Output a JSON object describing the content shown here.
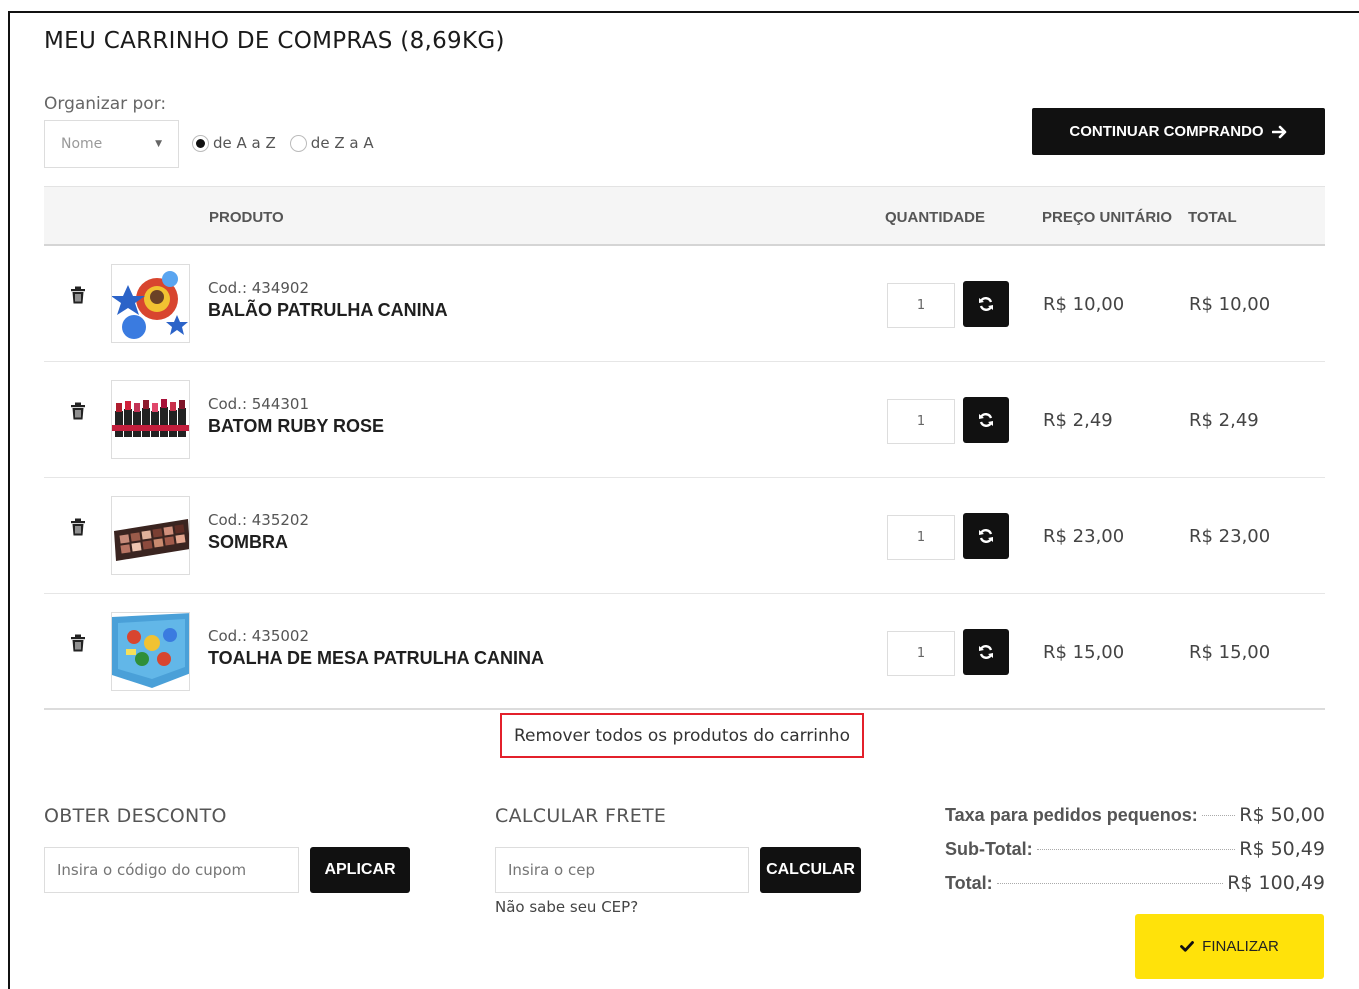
{
  "cart": {
    "title": "MEU CARRINHO DE COMPRAS (8,69KG)"
  },
  "sort": {
    "label": "Organizar por:",
    "select_value": "Nome",
    "options": [
      {
        "label": "de A a Z",
        "checked": true
      },
      {
        "label": "de Z a A",
        "checked": false
      }
    ]
  },
  "continue_button": {
    "label": "CONTINUAR COMPRANDO",
    "icon": "arrow-right-icon"
  },
  "table": {
    "headers": {
      "product": "PRODUTO",
      "quantity": "QUANTIDADE",
      "unit_price": "PREÇO UNITÁRIO",
      "total": "TOTAL"
    },
    "rows": [
      {
        "code": "Cod.: 434902",
        "name": "BALÃO PATRULHA CANINA",
        "qty": "1",
        "unit_price": "R$ 10,00",
        "total": "R$ 10,00",
        "thumb": "balloon-image"
      },
      {
        "code": "Cod.: 544301",
        "name": "BATOM RUBY ROSE",
        "qty": "1",
        "unit_price": "R$ 2,49",
        "total": "R$ 2,49",
        "thumb": "lipstick-image"
      },
      {
        "code": "Cod.: 435202",
        "name": "SOMBRA",
        "qty": "1",
        "unit_price": "R$ 23,00",
        "total": "R$ 23,00",
        "thumb": "eyeshadow-image"
      },
      {
        "code": "Cod.: 435002",
        "name": "TOALHA DE MESA PATRULHA CANINA",
        "qty": "1",
        "unit_price": "R$ 15,00",
        "total": "R$ 15,00",
        "thumb": "tablecloth-image"
      }
    ]
  },
  "remove_all": {
    "label": "Remover todos os produtos do carrinho"
  },
  "discount": {
    "title": "OBTER DESCONTO",
    "placeholder": "Insira o código do cupom",
    "button": "APLICAR"
  },
  "shipping": {
    "title": "CALCULAR FRETE",
    "placeholder": "Insira o cep",
    "button": "CALCULAR",
    "help_link": "Não sabe seu CEP?"
  },
  "summary": {
    "small_order_fee_label": "Taxa para pedidos pequenos:",
    "small_order_fee_value": "R$ 50,00",
    "subtotal_label": "Sub-Total:",
    "subtotal_value": "R$ 50,49",
    "total_label": "Total:",
    "total_value": "R$ 100,49"
  },
  "finish_button": {
    "label": "FINALIZAR",
    "icon": "check-icon"
  },
  "colors": {
    "dark": "#111111",
    "accent_yellow": "#ffe20a",
    "highlight_red": "#e3202b"
  }
}
